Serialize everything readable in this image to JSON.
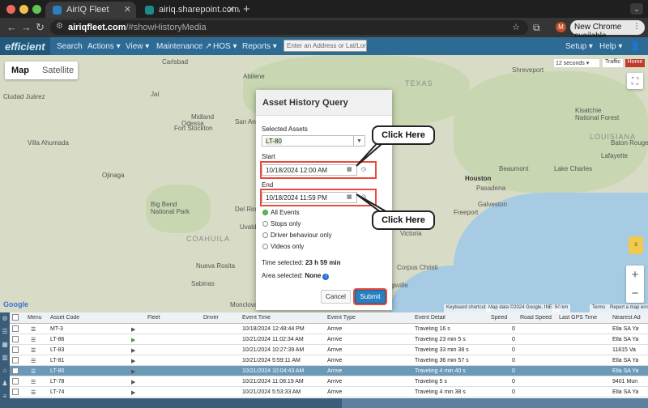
{
  "browser": {
    "tabs": [
      {
        "title": "AirIQ Fleet",
        "active": true
      },
      {
        "title": "airiq.sharepoint.com/sites/Pr",
        "active": false
      }
    ],
    "url_host": "airiqfleet.com",
    "url_path": "/#showHistoryMedia",
    "profile_initial": "M",
    "update_chip": "New Chrome available",
    "colors": {
      "tab_active": "#3a3a3a",
      "traffic_red": "#ed6a5e",
      "traffic_yellow": "#f5bf4f",
      "traffic_green": "#61c554"
    }
  },
  "appnav": {
    "logo_text": "efficient",
    "menus": [
      "Search",
      "Actions",
      "View",
      "Maintenance",
      "HOS",
      "Reports"
    ],
    "search_placeholder": "Enter an Address or Lat/Long",
    "right_menus": [
      "Setup",
      "Help"
    ],
    "icons": [
      "external-link-icon",
      "chevron-down-icon",
      "user-icon"
    ]
  },
  "map": {
    "map_button": "Map",
    "satellite_button": "Satellite",
    "refresh_label": "12 seconds",
    "traffic_label": "Traffic",
    "home_label": "Home",
    "pegman_label": "♀",
    "cities": [
      "Ciudad Juárez",
      "Midland",
      "Odessa",
      "Abilene",
      "Fort Stockton",
      "San Angelo",
      "Villa Ahumada",
      "Big Bend National Park",
      "Del Rio",
      "Uvalde",
      "Monclova",
      "Nueva Rosita",
      "Houston",
      "Beaumont",
      "Lake Charles",
      "Shreveport",
      "Pasadena",
      "Galveston",
      "Freeport",
      "Victoria",
      "Corpus Christi",
      "Kingsville",
      "Kisatchie National Forest",
      "Lafayette",
      "Baton Rouge",
      "Carlsbad",
      "Jal",
      "Ojinaga",
      "Sabinas"
    ],
    "states": [
      "TEXAS",
      "LOUISIANA",
      "COAHUILA"
    ],
    "attribution": [
      "Keyboard shortcuts",
      "Map data ©2024 Google, INEGI",
      "50 km",
      "Terms",
      "Report a map error"
    ],
    "google_logo": "Google"
  },
  "modal": {
    "title": "Asset History Query",
    "selected_assets_label": "Selected Assets",
    "selected_asset": "LT-80",
    "start_label": "Start",
    "start_value": "10/18/2024 12:00 AM",
    "end_label": "End",
    "end_value": "10/18/2024 11:59 PM",
    "options": [
      {
        "label": "All Events",
        "selected": true
      },
      {
        "label": "Stops only",
        "selected": false
      },
      {
        "label": "Driver behaviour only",
        "selected": false
      },
      {
        "label": "Videos only",
        "selected": false
      }
    ],
    "time_selected_label": "Time selected:",
    "time_selected_value": "23 h 59 min",
    "area_selected_label": "Area selected:",
    "area_selected_value": "None",
    "cancel_label": "Cancel",
    "submit_label": "Submit",
    "highlight_color": "#e74c3c"
  },
  "callouts": [
    "Click Here",
    "Click Here"
  ],
  "grid": {
    "columns": [
      "Menu",
      "Asset Code",
      "Fleet",
      "Driver",
      "Event Time",
      "Event Type",
      "Event Detail",
      "Speed",
      "Road Speed",
      "Last GPS Time",
      "Nearest Ad"
    ],
    "rows": [
      {
        "asset": "MT-3",
        "time": "10/18/2024 12:48:44 PM",
        "type": "Arrive",
        "detail": "Traveling 16 s",
        "speed": "0",
        "nearest": "Ella SA Ya",
        "selected": false
      },
      {
        "asset": "LT-86",
        "time": "10/21/2024 11:02:34 AM",
        "type": "Arrive",
        "detail": "Traveling 23 min 5 s",
        "speed": "0",
        "nearest": "Ella SA Ya",
        "selected": false
      },
      {
        "asset": "LT-83",
        "time": "10/21/2024 10:27:39 AM",
        "type": "Arrive",
        "detail": "Traveling 33 min 38 s",
        "speed": "0",
        "nearest": "11815 Va",
        "selected": false
      },
      {
        "asset": "LT-81",
        "time": "10/21/2024 5:59:11 AM",
        "type": "Arrive",
        "detail": "Traveling 36 min 57 s",
        "speed": "0",
        "nearest": "Ella SA Ya",
        "selected": false
      },
      {
        "asset": "LT-80",
        "time": "10/21/2024 10:04:43 AM",
        "type": "Arrive",
        "detail": "Traveling 4 min 40 s",
        "speed": "0",
        "nearest": "Ella SA Ya",
        "selected": true
      },
      {
        "asset": "LT-78",
        "time": "10/21/2024 11:08:19 AM",
        "type": "Arrive",
        "detail": "Traveling 5 s",
        "speed": "0",
        "nearest": "9401 Mun",
        "selected": false
      },
      {
        "asset": "LT-74",
        "time": "10/21/2024 5:53:33 AM",
        "type": "Arrive",
        "detail": "Traveling 4 min 38 s",
        "speed": "0",
        "nearest": "Ella SA Ya",
        "selected": false
      }
    ]
  }
}
